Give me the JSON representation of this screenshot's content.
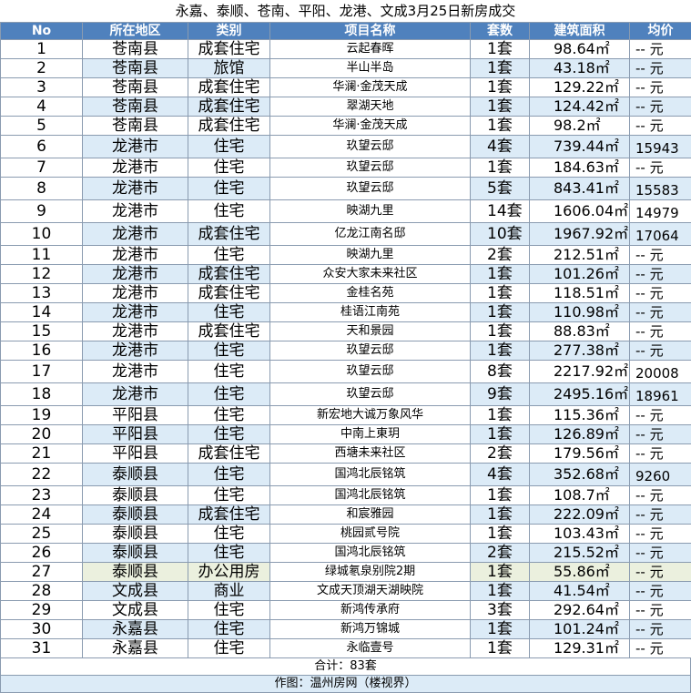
{
  "title": "永嘉、泰顺、苍南、平阳、龙港、文成3月25日新房成交",
  "headers": {
    "no": "No",
    "region": "所在地区",
    "type": "类别",
    "project": "项目名称",
    "count": "套数",
    "area": "建筑面积",
    "avg": "均价"
  },
  "rows": [
    {
      "no": "1",
      "region": "苍南县",
      "type": "成套住宅",
      "project": "云起春晖",
      "count": "1套",
      "area": "98.64㎡",
      "avg": "-- 元"
    },
    {
      "no": "2",
      "region": "苍南县",
      "type": "旅馆",
      "project": "半山半岛",
      "count": "1套",
      "area": "43.18㎡",
      "avg": "-- 元"
    },
    {
      "no": "3",
      "region": "苍南县",
      "type": "成套住宅",
      "project": "华澜·金茂天成",
      "count": "1套",
      "area": "129.22㎡",
      "avg": "-- 元"
    },
    {
      "no": "4",
      "region": "苍南县",
      "type": "成套住宅",
      "project": "翠湖天地",
      "count": "1套",
      "area": "124.42㎡",
      "avg": "-- 元"
    },
    {
      "no": "5",
      "region": "苍南县",
      "type": "成套住宅",
      "project": "华澜·金茂天成",
      "count": "1套",
      "area": "98.2㎡",
      "avg": "-- 元"
    },
    {
      "no": "6",
      "region": "龙港市",
      "type": "住宅",
      "project": "玖望云邸",
      "count": "4套",
      "area": "739.44㎡",
      "avg": "15943"
    },
    {
      "no": "7",
      "region": "龙港市",
      "type": "住宅",
      "project": "玖望云邸",
      "count": "1套",
      "area": "184.63㎡",
      "avg": "-- 元"
    },
    {
      "no": "8",
      "region": "龙港市",
      "type": "住宅",
      "project": "玖望云邸",
      "count": "5套",
      "area": "843.41㎡",
      "avg": "15583"
    },
    {
      "no": "9",
      "region": "龙港市",
      "type": "住宅",
      "project": "映湖九里",
      "count": "14套",
      "area": "1606.04㎡",
      "avg": "14979"
    },
    {
      "no": "10",
      "region": "龙港市",
      "type": "成套住宅",
      "project": "亿龙江南名邸",
      "count": "10套",
      "area": "1967.92㎡",
      "avg": "17064"
    },
    {
      "no": "11",
      "region": "龙港市",
      "type": "住宅",
      "project": "映湖九里",
      "count": "2套",
      "area": "212.51㎡",
      "avg": "-- 元"
    },
    {
      "no": "12",
      "region": "龙港市",
      "type": "成套住宅",
      "project": "众安大家未来社区",
      "count": "1套",
      "area": "101.26㎡",
      "avg": "-- 元"
    },
    {
      "no": "13",
      "region": "龙港市",
      "type": "成套住宅",
      "project": "金桂名苑",
      "count": "1套",
      "area": "118.51㎡",
      "avg": "-- 元"
    },
    {
      "no": "14",
      "region": "龙港市",
      "type": "住宅",
      "project": "桂语江南苑",
      "count": "1套",
      "area": "110.98㎡",
      "avg": "-- 元"
    },
    {
      "no": "15",
      "region": "龙港市",
      "type": "成套住宅",
      "project": "天和景园",
      "count": "1套",
      "area": "88.83㎡",
      "avg": "-- 元"
    },
    {
      "no": "16",
      "region": "龙港市",
      "type": "住宅",
      "project": "玖望云邸",
      "count": "1套",
      "area": "277.38㎡",
      "avg": "-- 元"
    },
    {
      "no": "17",
      "region": "龙港市",
      "type": "住宅",
      "project": "玖望云邸",
      "count": "8套",
      "area": "2217.92㎡",
      "avg": "20008"
    },
    {
      "no": "18",
      "region": "龙港市",
      "type": "住宅",
      "project": "玖望云邸",
      "count": "9套",
      "area": "2495.16㎡",
      "avg": "18961"
    },
    {
      "no": "19",
      "region": "平阳县",
      "type": "住宅",
      "project": "新宏地大诚万象风华",
      "count": "1套",
      "area": "115.36㎡",
      "avg": "-- 元"
    },
    {
      "no": "20",
      "region": "平阳县",
      "type": "住宅",
      "project": "中南上東玥",
      "count": "1套",
      "area": "126.89㎡",
      "avg": "-- 元"
    },
    {
      "no": "21",
      "region": "平阳县",
      "type": "成套住宅",
      "project": "西塘未来社区",
      "count": "2套",
      "area": "179.56㎡",
      "avg": "-- 元"
    },
    {
      "no": "22",
      "region": "泰顺县",
      "type": "住宅",
      "project": "国鸿北辰铭筑",
      "count": "4套",
      "area": "352.68㎡",
      "avg": "9260"
    },
    {
      "no": "23",
      "region": "泰顺县",
      "type": "住宅",
      "project": "国鸿北辰铭筑",
      "count": "1套",
      "area": "108.7㎡",
      "avg": "-- 元"
    },
    {
      "no": "24",
      "region": "泰顺县",
      "type": "成套住宅",
      "project": "和宸雅园",
      "count": "1套",
      "area": "222.09㎡",
      "avg": "-- 元"
    },
    {
      "no": "25",
      "region": "泰顺县",
      "type": "住宅",
      "project": "桃园贰号院",
      "count": "1套",
      "area": "103.43㎡",
      "avg": "-- 元"
    },
    {
      "no": "26",
      "region": "泰顺县",
      "type": "住宅",
      "project": "国鸿北辰铭筑",
      "count": "2套",
      "area": "215.52㎡",
      "avg": "-- 元"
    },
    {
      "no": "27",
      "region": "泰顺县",
      "type": "办公用房",
      "project": "绿城氡泉别院2期",
      "count": "1套",
      "area": "55.86㎡",
      "avg": "-- 元"
    },
    {
      "no": "28",
      "region": "文成县",
      "type": "商业",
      "project": "文成天顶湖天湖映院",
      "count": "1套",
      "area": "41.54㎡",
      "avg": "-- 元"
    },
    {
      "no": "29",
      "region": "文成县",
      "type": "住宅",
      "project": "新鸿传承府",
      "count": "3套",
      "area": "292.64㎡",
      "avg": "-- 元"
    },
    {
      "no": "30",
      "region": "永嘉县",
      "type": "住宅",
      "project": "新鸿万锦城",
      "count": "1套",
      "area": "101.24㎡",
      "avg": "-- 元"
    },
    {
      "no": "31",
      "region": "永嘉县",
      "type": "住宅",
      "project": "永临壹号",
      "count": "1套",
      "area": "129.31㎡",
      "avg": "-- 元"
    }
  ],
  "footer": {
    "total": "合计：83套",
    "credit": "作图：温州房网（楼视界）"
  },
  "colors": {
    "header_bg": "#4f81bd",
    "alt_row": "#dcebf7",
    "highlight_row": "#ebf0de"
  }
}
